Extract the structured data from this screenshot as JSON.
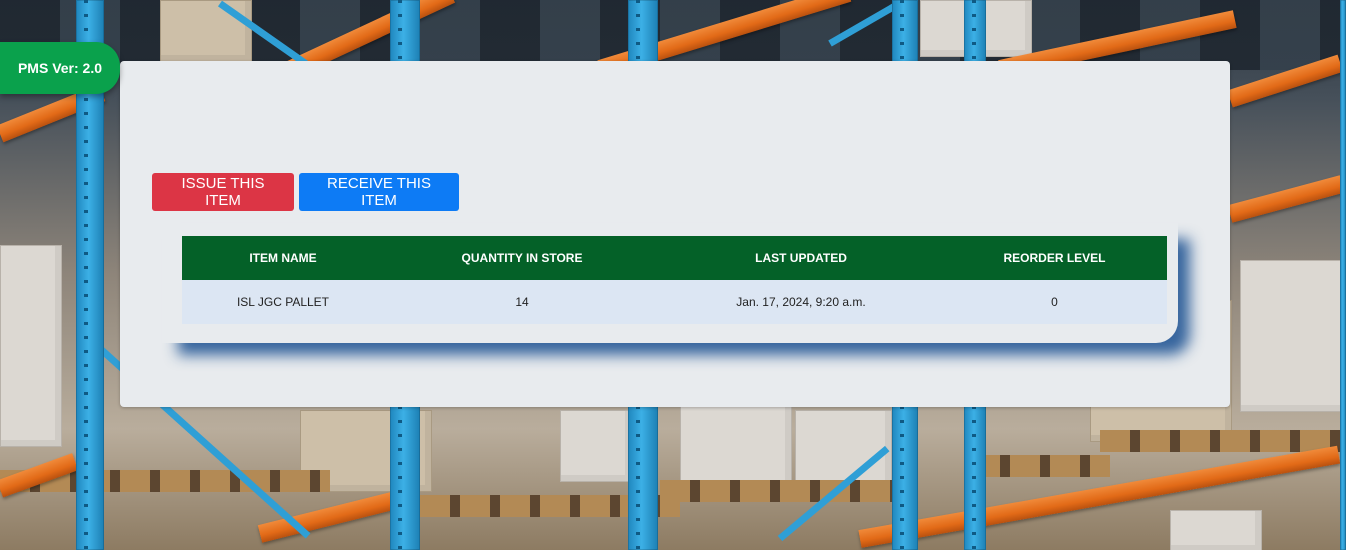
{
  "badge": {
    "label": "PMS Ver: 2.0"
  },
  "actions": {
    "issue_label": "ISSUE THIS ITEM",
    "receive_label": "RECEIVE THIS ITEM"
  },
  "table": {
    "headers": [
      "ITEM NAME",
      "QUANTITY IN STORE",
      "LAST UPDATED",
      "REORDER LEVEL"
    ],
    "rows": [
      {
        "item_name": "ISL JGC PALLET",
        "quantity": "14",
        "last_updated": "Jan. 17, 2024, 9:20 a.m.",
        "reorder_level": "0"
      }
    ]
  },
  "colors": {
    "badge": "#0aa14c",
    "issue_button": "#dc3545",
    "receive_button": "#0d7bf5",
    "table_header": "#046128",
    "table_row": "#dce6f3"
  }
}
